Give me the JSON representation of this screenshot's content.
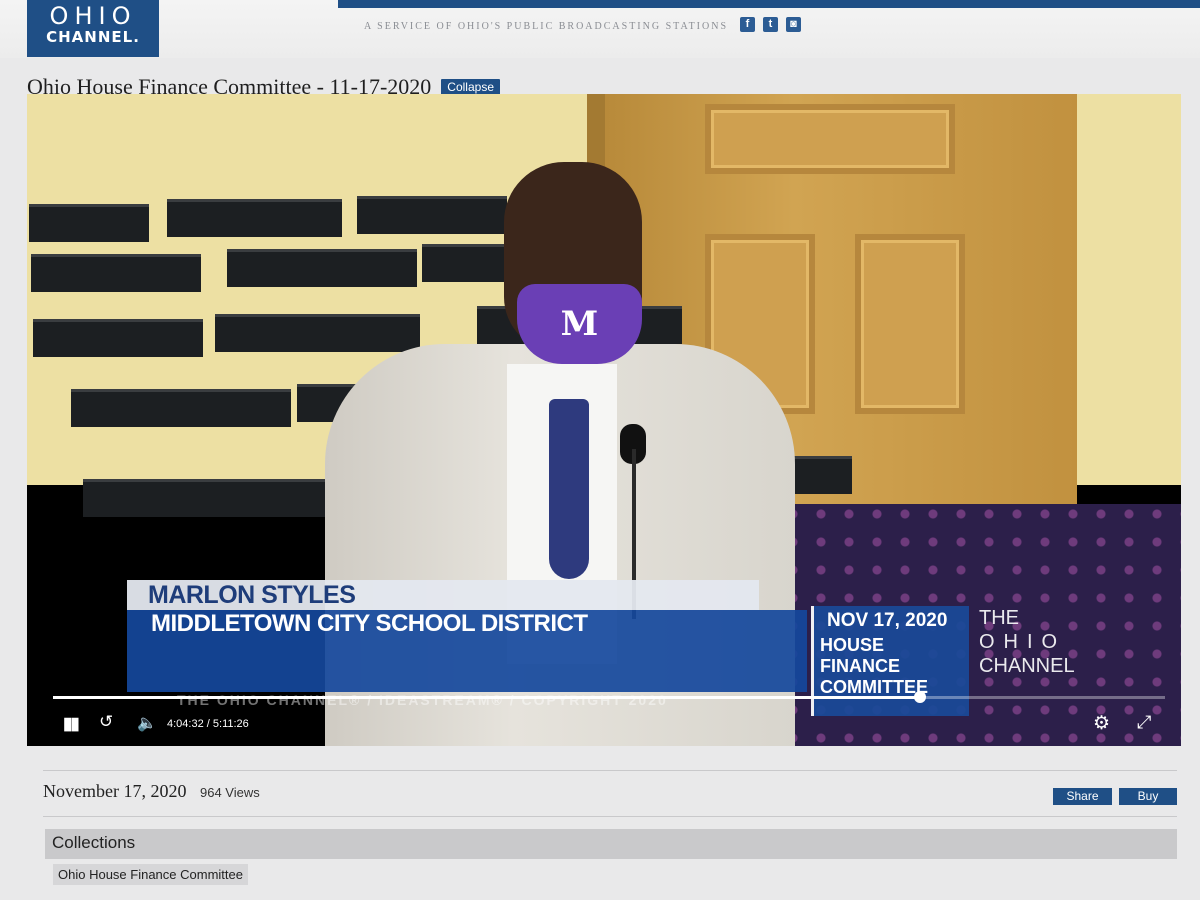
{
  "header": {
    "logo_line1": "OHIO",
    "logo_line2": "CHANNEL.",
    "tagline": "A SERVICE OF OHIO'S PUBLIC BROADCASTING STATIONS",
    "social": [
      {
        "icon": "facebook-icon",
        "glyph": "f"
      },
      {
        "icon": "twitter-icon",
        "glyph": "t"
      },
      {
        "icon": "instagram-icon",
        "glyph": "◙"
      }
    ],
    "brand_color": "#1f4f86"
  },
  "page": {
    "title": "Ohio House Finance Committee - 11-17-2020",
    "collapse_label": "Collapse"
  },
  "video": {
    "lower_third": {
      "name": "MARLON STYLES",
      "organization": "MIDDLETOWN CITY SCHOOL DISTRICT",
      "date": "NOV 17, 2020",
      "event_line1": "HOUSE",
      "event_line2": "FINANCE",
      "event_line3": "COMMITTEE",
      "brand_the": "THE",
      "brand_ohio": "OHIO",
      "brand_channel": "CHANNEL",
      "copyright": "THE OHIO CHANNEL® / IDEASTREAM® / COPYRIGHT 2020"
    },
    "mask_letter": "M",
    "current_time": "4:04:32",
    "duration": "5:11:26",
    "progress_fraction": 0.78,
    "time_separator": "/",
    "controls": {
      "play_pause_glyph": "▮▮",
      "rewind_glyph": "↺",
      "volume_glyph": "🔈",
      "settings_glyph": "⚙",
      "fullscreen_glyph": "⤢"
    }
  },
  "meta": {
    "date": "November 17, 2020",
    "views": "964 Views",
    "share_label": "Share",
    "buy_label": "Buy"
  },
  "collections": {
    "heading": "Collections",
    "items": [
      "Ohio House Finance Committee"
    ]
  }
}
